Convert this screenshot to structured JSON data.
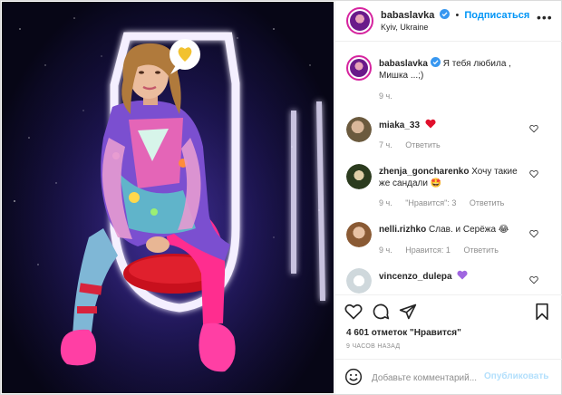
{
  "post": {
    "author": "babaslavka",
    "follow_label": "Подписаться",
    "location": "Kyiv, Ukraine",
    "caption": "Я тебя любила , Мишка ...;)",
    "caption_time": "9 ч."
  },
  "photo": {
    "speech_bubble_icon": "yellow-heart",
    "colors": {
      "neon": "#f2ecff",
      "glow": "#8b6dff",
      "pink": "#ff2d8f",
      "stool": "#d01020"
    }
  },
  "comments": [
    {
      "user": "miaka_33",
      "text": "",
      "emoji": "red-heart",
      "time": "7 ч.",
      "likes": "",
      "reply": "Ответить"
    },
    {
      "user": "zhenja_goncharenko",
      "text": "Хочу такие же сандали 🤩",
      "time": "9 ч.",
      "likes": "\"Нравится\": 3",
      "reply": "Ответить"
    },
    {
      "user": "nelli.rizhko",
      "text": "Слав. и Серёжа 😂",
      "time": "9 ч.",
      "likes": "Нравится: 1",
      "reply": "Ответить"
    },
    {
      "user": "vincenzo_dulepa",
      "text": "",
      "emoji": "purple-heart",
      "time": "",
      "likes": "",
      "reply": ""
    }
  ],
  "footer": {
    "likes_text": "4 601 отметок \"Нравится\"",
    "time_ago": "9 ЧАСОВ НАЗАД",
    "comment_placeholder": "Добавьте комментарий...",
    "publish_label": "Опубликовать"
  },
  "icons": [
    "heart-icon",
    "comment-icon",
    "share-icon",
    "bookmark-icon",
    "emoji-icon",
    "more-icon",
    "verified-badge-icon"
  ],
  "accent": {
    "blue": "#0095f6",
    "muted": "#8e8e8e",
    "heart_red": "#ed4956",
    "purple_heart": "#a066e0"
  }
}
